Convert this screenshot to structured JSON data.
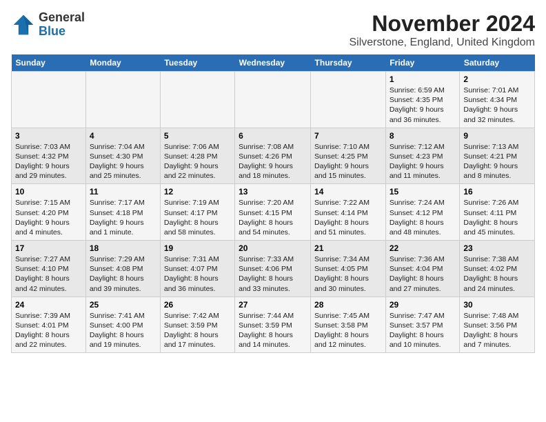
{
  "header": {
    "logo_general": "General",
    "logo_blue": "Blue",
    "month": "November 2024",
    "location": "Silverstone, England, United Kingdom"
  },
  "weekdays": [
    "Sunday",
    "Monday",
    "Tuesday",
    "Wednesday",
    "Thursday",
    "Friday",
    "Saturday"
  ],
  "weeks": [
    [
      {
        "day": "",
        "info": ""
      },
      {
        "day": "",
        "info": ""
      },
      {
        "day": "",
        "info": ""
      },
      {
        "day": "",
        "info": ""
      },
      {
        "day": "",
        "info": ""
      },
      {
        "day": "1",
        "info": "Sunrise: 6:59 AM\nSunset: 4:35 PM\nDaylight: 9 hours and 36 minutes."
      },
      {
        "day": "2",
        "info": "Sunrise: 7:01 AM\nSunset: 4:34 PM\nDaylight: 9 hours and 32 minutes."
      }
    ],
    [
      {
        "day": "3",
        "info": "Sunrise: 7:03 AM\nSunset: 4:32 PM\nDaylight: 9 hours and 29 minutes."
      },
      {
        "day": "4",
        "info": "Sunrise: 7:04 AM\nSunset: 4:30 PM\nDaylight: 9 hours and 25 minutes."
      },
      {
        "day": "5",
        "info": "Sunrise: 7:06 AM\nSunset: 4:28 PM\nDaylight: 9 hours and 22 minutes."
      },
      {
        "day": "6",
        "info": "Sunrise: 7:08 AM\nSunset: 4:26 PM\nDaylight: 9 hours and 18 minutes."
      },
      {
        "day": "7",
        "info": "Sunrise: 7:10 AM\nSunset: 4:25 PM\nDaylight: 9 hours and 15 minutes."
      },
      {
        "day": "8",
        "info": "Sunrise: 7:12 AM\nSunset: 4:23 PM\nDaylight: 9 hours and 11 minutes."
      },
      {
        "day": "9",
        "info": "Sunrise: 7:13 AM\nSunset: 4:21 PM\nDaylight: 9 hours and 8 minutes."
      }
    ],
    [
      {
        "day": "10",
        "info": "Sunrise: 7:15 AM\nSunset: 4:20 PM\nDaylight: 9 hours and 4 minutes."
      },
      {
        "day": "11",
        "info": "Sunrise: 7:17 AM\nSunset: 4:18 PM\nDaylight: 9 hours and 1 minute."
      },
      {
        "day": "12",
        "info": "Sunrise: 7:19 AM\nSunset: 4:17 PM\nDaylight: 8 hours and 58 minutes."
      },
      {
        "day": "13",
        "info": "Sunrise: 7:20 AM\nSunset: 4:15 PM\nDaylight: 8 hours and 54 minutes."
      },
      {
        "day": "14",
        "info": "Sunrise: 7:22 AM\nSunset: 4:14 PM\nDaylight: 8 hours and 51 minutes."
      },
      {
        "day": "15",
        "info": "Sunrise: 7:24 AM\nSunset: 4:12 PM\nDaylight: 8 hours and 48 minutes."
      },
      {
        "day": "16",
        "info": "Sunrise: 7:26 AM\nSunset: 4:11 PM\nDaylight: 8 hours and 45 minutes."
      }
    ],
    [
      {
        "day": "17",
        "info": "Sunrise: 7:27 AM\nSunset: 4:10 PM\nDaylight: 8 hours and 42 minutes."
      },
      {
        "day": "18",
        "info": "Sunrise: 7:29 AM\nSunset: 4:08 PM\nDaylight: 8 hours and 39 minutes."
      },
      {
        "day": "19",
        "info": "Sunrise: 7:31 AM\nSunset: 4:07 PM\nDaylight: 8 hours and 36 minutes."
      },
      {
        "day": "20",
        "info": "Sunrise: 7:33 AM\nSunset: 4:06 PM\nDaylight: 8 hours and 33 minutes."
      },
      {
        "day": "21",
        "info": "Sunrise: 7:34 AM\nSunset: 4:05 PM\nDaylight: 8 hours and 30 minutes."
      },
      {
        "day": "22",
        "info": "Sunrise: 7:36 AM\nSunset: 4:04 PM\nDaylight: 8 hours and 27 minutes."
      },
      {
        "day": "23",
        "info": "Sunrise: 7:38 AM\nSunset: 4:02 PM\nDaylight: 8 hours and 24 minutes."
      }
    ],
    [
      {
        "day": "24",
        "info": "Sunrise: 7:39 AM\nSunset: 4:01 PM\nDaylight: 8 hours and 22 minutes."
      },
      {
        "day": "25",
        "info": "Sunrise: 7:41 AM\nSunset: 4:00 PM\nDaylight: 8 hours and 19 minutes."
      },
      {
        "day": "26",
        "info": "Sunrise: 7:42 AM\nSunset: 3:59 PM\nDaylight: 8 hours and 17 minutes."
      },
      {
        "day": "27",
        "info": "Sunrise: 7:44 AM\nSunset: 3:59 PM\nDaylight: 8 hours and 14 minutes."
      },
      {
        "day": "28",
        "info": "Sunrise: 7:45 AM\nSunset: 3:58 PM\nDaylight: 8 hours and 12 minutes."
      },
      {
        "day": "29",
        "info": "Sunrise: 7:47 AM\nSunset: 3:57 PM\nDaylight: 8 hours and 10 minutes."
      },
      {
        "day": "30",
        "info": "Sunrise: 7:48 AM\nSunset: 3:56 PM\nDaylight: 8 hours and 7 minutes."
      }
    ]
  ]
}
